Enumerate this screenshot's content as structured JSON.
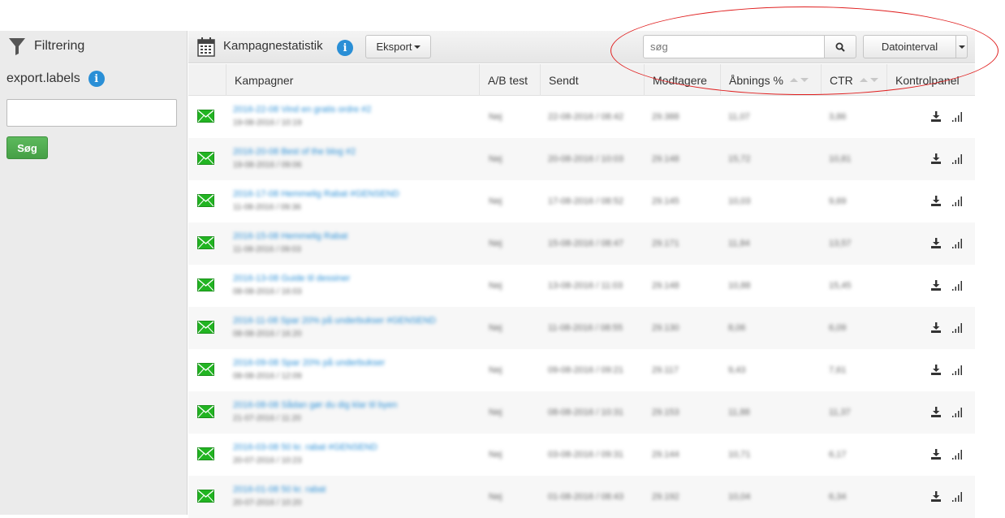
{
  "sidebar": {
    "filter_title": "Filtrering",
    "export_labels": "export.labels",
    "info_label": "i",
    "search_button": "Søg"
  },
  "toolbar": {
    "title": "Kampagnestatistik",
    "info_label": "i",
    "export_label": "Eksport",
    "search_placeholder": "søg",
    "date_interval_label": "Datointerval"
  },
  "table": {
    "columns": [
      "Kampagner",
      "A/B test",
      "Sendt",
      "Modtagere",
      "Åbnings %",
      "CTR",
      "Kontrolpanel"
    ],
    "rows": [
      {
        "name": "2016-22-08 Vind en gratis ordre #2",
        "date": "19-08-2016 / 10:19",
        "ab": "Nej",
        "sent": "22-08-2016 / 08:42",
        "recipients": "29.388",
        "open": "11,07",
        "ctr": "3,86"
      },
      {
        "name": "2016-20-08 Best of the blog #2",
        "date": "19-08-2016 / 09:06",
        "ab": "Nej",
        "sent": "20-08-2016 / 10:03",
        "recipients": "29.148",
        "open": "15,72",
        "ctr": "10,81"
      },
      {
        "name": "2016-17-08 Hemmelig Rabat #GENSEND",
        "date": "11-08-2016 / 09:36",
        "ab": "Nej",
        "sent": "17-08-2016 / 08:52",
        "recipients": "29.145",
        "open": "10,03",
        "ctr": "9,69"
      },
      {
        "name": "2016-15-08 Hemmelig Rabat",
        "date": "11-08-2016 / 09:03",
        "ab": "Nej",
        "sent": "15-08-2016 / 08:47",
        "recipients": "29.171",
        "open": "11,84",
        "ctr": "13,57"
      },
      {
        "name": "2016-13-08 Guide til dessiner",
        "date": "08-08-2016 / 16:03",
        "ab": "Nej",
        "sent": "13-08-2016 / 11:03",
        "recipients": "29.148",
        "open": "10,88",
        "ctr": "15,45"
      },
      {
        "name": "2016-11-08 Spar 20% på underbukser #GENSEND",
        "date": "08-08-2016 / 16:20",
        "ab": "Nej",
        "sent": "11-08-2016 / 08:55",
        "recipients": "29.130",
        "open": "8,06",
        "ctr": "6,09"
      },
      {
        "name": "2016-09-08 Spar 20% på underbukser",
        "date": "08-08-2016 / 12:09",
        "ab": "Nej",
        "sent": "09-08-2016 / 09:21",
        "recipients": "29.117",
        "open": "9,43",
        "ctr": "7,61"
      },
      {
        "name": "2016-08-08 Sådan gør du dig klar til byen",
        "date": "21-07-2016 / 11:20",
        "ab": "Nej",
        "sent": "08-08-2016 / 10:31",
        "recipients": "29.153",
        "open": "11,88",
        "ctr": "11,37"
      },
      {
        "name": "2016-03-08 50 kr. rabat #GENSEND",
        "date": "20-07-2016 / 10:23",
        "ab": "Nej",
        "sent": "03-08-2016 / 09:31",
        "recipients": "29.144",
        "open": "10,71",
        "ctr": "6,17"
      },
      {
        "name": "2016-01-08 50 kr. rabat",
        "date": "20-07-2016 / 10:20",
        "ab": "Nej",
        "sent": "01-08-2016 / 08:43",
        "recipients": "29.192",
        "open": "10,04",
        "ctr": "6,34"
      }
    ]
  },
  "colors": {
    "accent_blue": "#2a8fd6",
    "search_green": "#4cae4c",
    "mail_green": "#22b422",
    "highlight_red": "#e02020"
  }
}
